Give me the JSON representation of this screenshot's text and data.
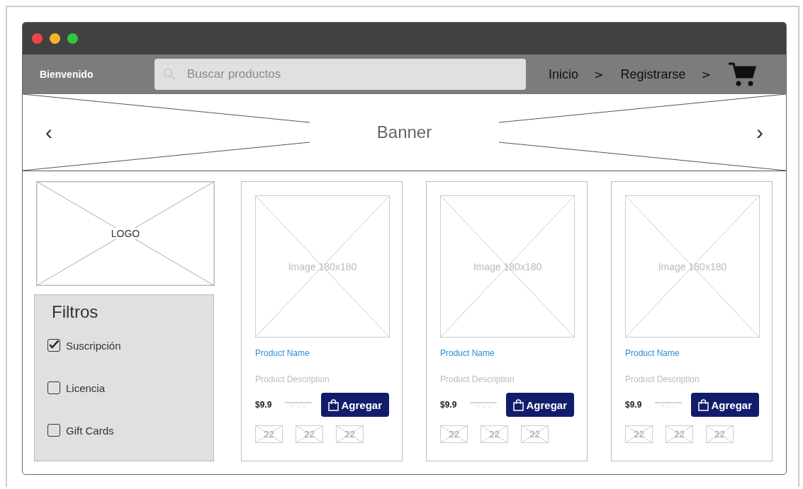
{
  "navbar": {
    "welcome": "Bienvenido",
    "search": {
      "placeholder": "Buscar productos"
    },
    "links": [
      {
        "label": "Inicio",
        "separator": ">"
      },
      {
        "label": "Registrarse",
        "separator": ">"
      }
    ]
  },
  "banner": {
    "prev": "‹",
    "title": "Banner",
    "next": "›"
  },
  "logo": "LOGO",
  "filters": {
    "title": "Filtros",
    "items": [
      {
        "label": "Suscripción",
        "checked": true
      },
      {
        "label": "Licencia",
        "checked": false
      },
      {
        "label": "Gift Cards",
        "checked": false
      }
    ]
  },
  "products": [
    {
      "image": "Image 180x180",
      "name": "Product Name",
      "description": "Product Description",
      "price": "$9.9",
      "button": "Agregar",
      "thumbnails": [
        "22",
        "22",
        "22"
      ]
    },
    {
      "image": "Image 180x180",
      "name": "Product Name",
      "description": "Product Description",
      "price": "$9.9",
      "button": "Agregar",
      "thumbnails": [
        "22",
        "22",
        "22"
      ]
    },
    {
      "image": "Image 180x180",
      "name": "Product Name",
      "description": "Product Description",
      "price": "$9.9",
      "button": "Agregar",
      "thumbnails": [
        "22",
        "22",
        "22"
      ]
    }
  ]
}
